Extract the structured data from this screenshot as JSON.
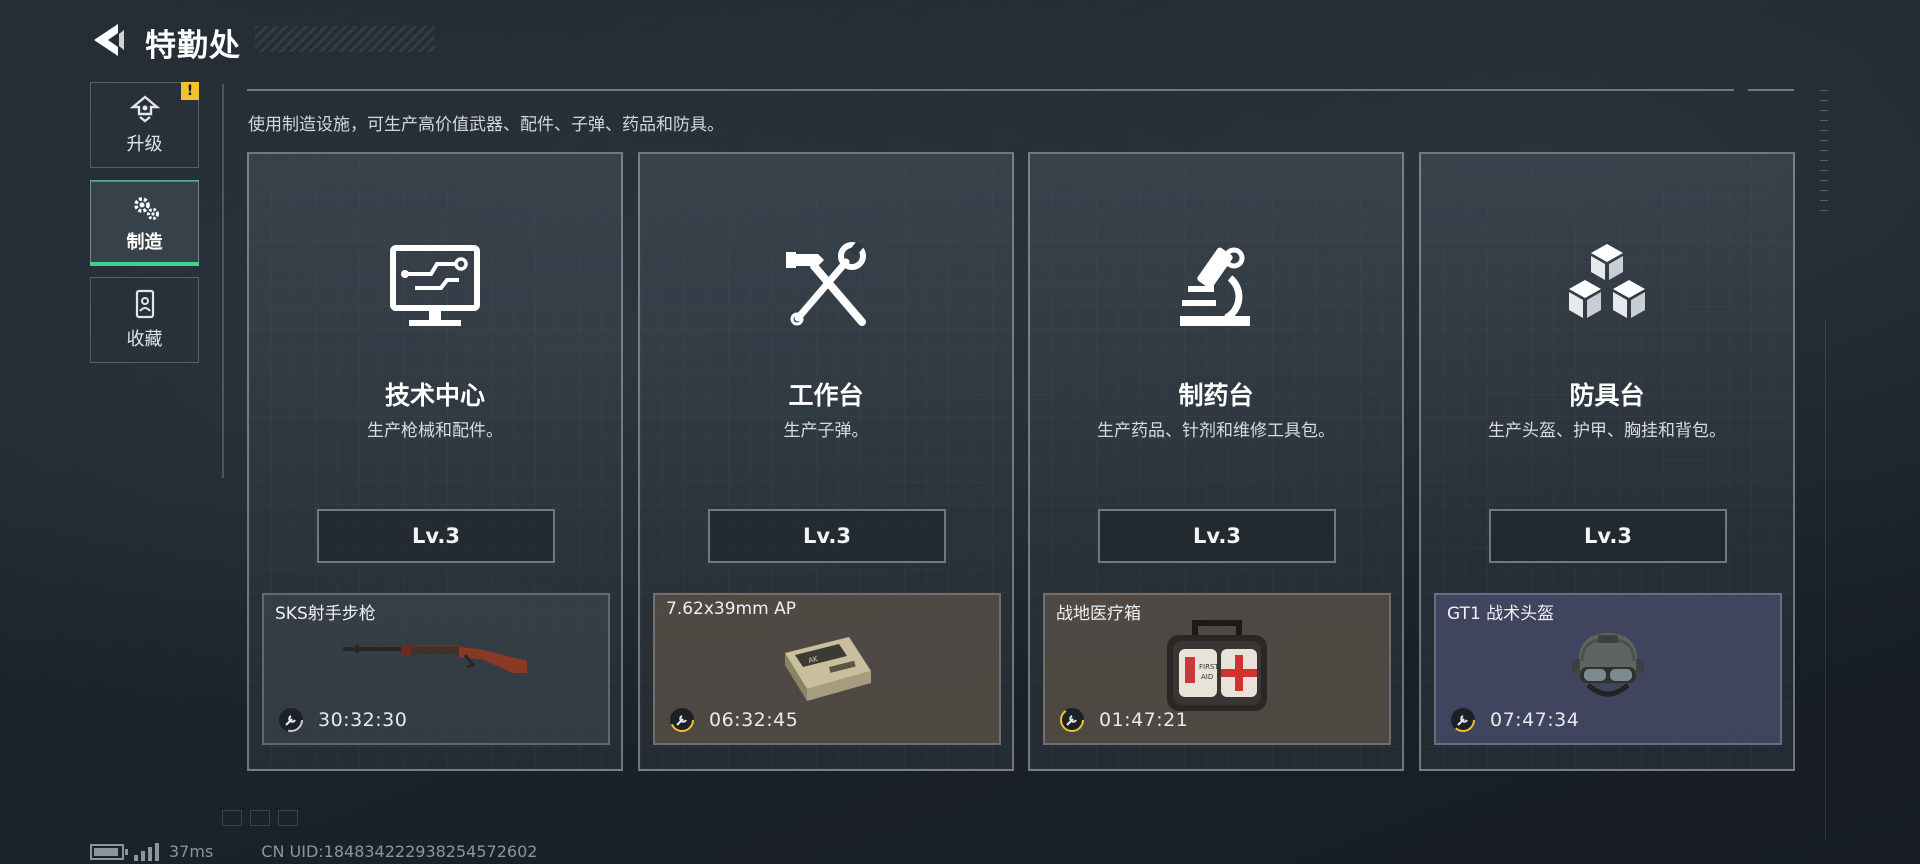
{
  "header": {
    "title": "特勤处",
    "back_icon": "back-arrow-icon"
  },
  "sidebar": {
    "items": [
      {
        "label": "升级",
        "icon": "upgrade-icon",
        "active": false,
        "alert": "!"
      },
      {
        "label": "制造",
        "icon": "gears-icon",
        "active": true
      },
      {
        "label": "收藏",
        "icon": "collection-icon",
        "active": false
      }
    ]
  },
  "main": {
    "description": "使用制造设施，可生产高价值武器、配件、子弹、药品和防具。",
    "stations": [
      {
        "title": "技术中心",
        "subtitle": "生产枪械和配件。",
        "icon": "computer-monitor-icon",
        "level": "Lv.3",
        "craft": {
          "name": "SKS射手步枪",
          "timer": "30:32:30",
          "image": "sks-rifle-icon",
          "bg": "gray",
          "timer_color": "#c8ced4"
        }
      },
      {
        "title": "工作台",
        "subtitle": "生产子弹。",
        "icon": "hammer-wrench-icon",
        "level": "Lv.3",
        "craft": {
          "name": "7.62x39mm AP",
          "timer": "06:32:45",
          "image": "ammo-box-icon",
          "bg": "brown",
          "timer_color": "#f2c230"
        }
      },
      {
        "title": "制药台",
        "subtitle": "生产药品、针剂和维修工具包。",
        "icon": "microscope-icon",
        "level": "Lv.3",
        "craft": {
          "name": "战地医疗箱",
          "timer": "01:47:21",
          "image": "first-aid-kit-icon",
          "bg": "brown",
          "timer_color": "#f2c230"
        }
      },
      {
        "title": "防具台",
        "subtitle": "生产头盔、护甲、胸挂和背包。",
        "icon": "cubes-icon",
        "level": "Lv.3",
        "craft": {
          "name": "GT1 战术头盔",
          "timer": "07:47:34",
          "image": "tactical-helmet-icon",
          "bg": "purple",
          "timer_color": "#f2c230"
        }
      }
    ]
  },
  "footer": {
    "ping": "37ms",
    "uid": "CN UID:184834222938254572602"
  },
  "colors": {
    "accent_green": "#39d48a",
    "alert_yellow": "#f2c230"
  }
}
